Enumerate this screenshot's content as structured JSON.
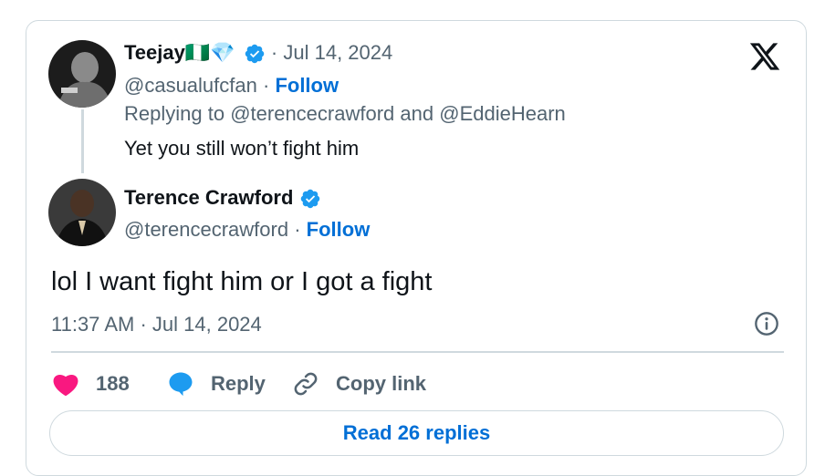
{
  "parent_tweet": {
    "author_name": "Teejay",
    "emoji_flag": "🇳🇬",
    "emoji_gem": "💎",
    "separator": "·",
    "date": "Jul 14, 2024",
    "handle": "@casualufcfan",
    "follow_label": "Follow",
    "reply_prefix": "Replying to",
    "reply_to_1": "@terencecrawford",
    "reply_and": "and",
    "reply_to_2": "@EddieHearn",
    "text": "Yet you still won’t fight him"
  },
  "main_tweet": {
    "author_name": "Terence Crawford",
    "handle": "@terencecrawford",
    "separator": "·",
    "follow_label": "Follow",
    "text": "lol I want fight him or I got a fight",
    "time": "11:37 AM",
    "date": "Jul 14, 2024"
  },
  "actions": {
    "like_count": "188",
    "reply_label": "Reply",
    "copy_link_label": "Copy link"
  },
  "read_replies_label": "Read 26 replies",
  "icons": {
    "logo": "x-logo-icon",
    "verified": "verified-badge-icon",
    "like": "heart-icon",
    "reply": "speech-bubble-icon",
    "copy_link": "link-icon",
    "info": "info-icon"
  },
  "colors": {
    "accent": "#006fd6",
    "verified": "#1d9bf0",
    "like": "#f91880",
    "muted": "#536471",
    "border": "#cfd9de"
  }
}
